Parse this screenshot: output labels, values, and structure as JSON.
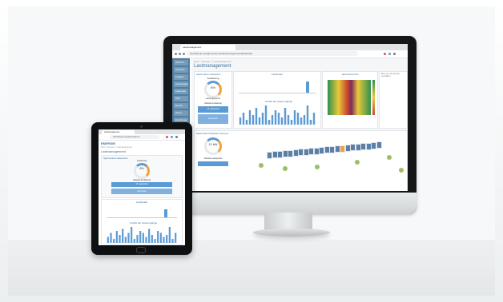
{
  "browser": {
    "tab_title": "Lastmanagement",
    "url": "hochschule.energiemonitor.de/lastmanagement/dashboard",
    "tablet_url": "hochschule.energiemonitor.de"
  },
  "app": {
    "logo": "ENERGIE",
    "breadcrumb": "Start > Energie > Lastmanagement",
    "page_title": "Lastmanagement"
  },
  "sidebar": {
    "items": [
      "Übersicht",
      "Verbrauch",
      "Lastgang",
      "Lastmanagement",
      "Ladepunkte",
      "Tarife",
      "Berichte",
      "Alarme",
      "Einstellungen"
    ]
  },
  "dashboard": {
    "left_card_title": "Spitzenlast Lastspitzen",
    "gauge_label": "Auslastung",
    "gauge_value": "8%",
    "gauge_sub": "Leistungsgrenze",
    "status_label": "Aktuelle Auslastung",
    "status_value": "13 Ladepunkt",
    "status_box": "Grenzwert",
    "chart_title": "Lastbedarf",
    "histo_title": "Anzahl der Ladevorgänge",
    "heatmap_title": "Jahresübersicht",
    "right_panel": "Bitte eine Messstelle auswählen",
    "bottom_card_title": "Spitzenlast Parkplatz Campus",
    "bottom_gauge_value": "11 kW",
    "bottom_status": "Aktuelle Ladepunkte"
  },
  "chart_data": {
    "type": "bar",
    "title": "Anzahl der Ladevorgänge",
    "categories": [
      "1",
      "2",
      "3",
      "4",
      "5",
      "6",
      "7",
      "8",
      "9",
      "10",
      "11",
      "12",
      "13",
      "14",
      "15",
      "16",
      "17",
      "18",
      "19",
      "20",
      "21",
      "22",
      "23",
      "24"
    ],
    "values": [
      3,
      5,
      2,
      6,
      4,
      7,
      3,
      5,
      8,
      2,
      4,
      6,
      5,
      3,
      7,
      4,
      2,
      6,
      5,
      3,
      4,
      8,
      2,
      5
    ],
    "xlabel": "",
    "ylabel": ""
  },
  "colors": {
    "accent": "#5b9bd5",
    "sidebar": "#4f7fa4",
    "orange": "#f0a23a",
    "highlight_segment": "#f0a23a"
  }
}
